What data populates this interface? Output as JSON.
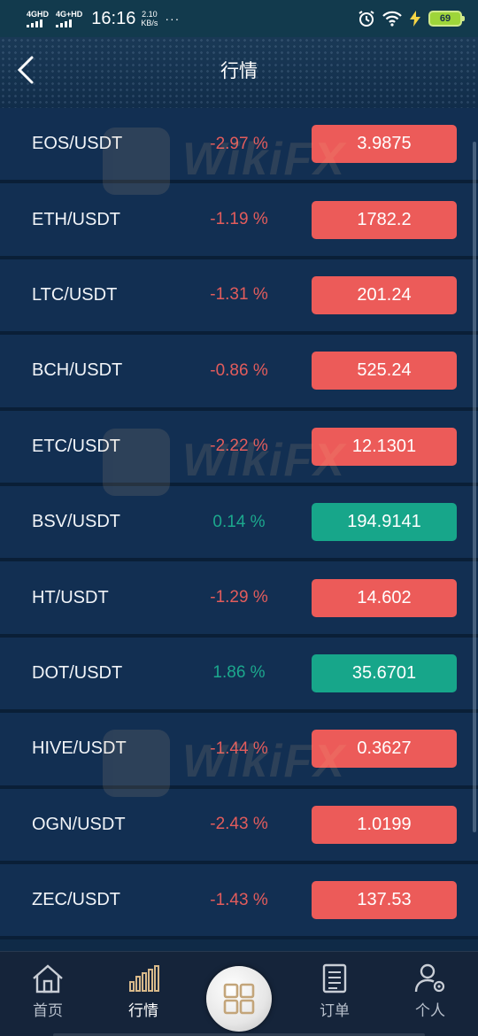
{
  "status_bar": {
    "network1": "4GHD",
    "network2": "4G+HD",
    "time": "16:16",
    "speed_value": "2.10",
    "speed_unit": "KB/s",
    "more": "···",
    "battery": "69"
  },
  "header": {
    "title": "行情"
  },
  "market": [
    {
      "pair": "EOS/USDT",
      "change": "-2.97 %",
      "price": "3.9875",
      "direction": "down"
    },
    {
      "pair": "ETH/USDT",
      "change": "-1.19 %",
      "price": "1782.2",
      "direction": "down"
    },
    {
      "pair": "LTC/USDT",
      "change": "-1.31 %",
      "price": "201.24",
      "direction": "down"
    },
    {
      "pair": "BCH/USDT",
      "change": "-0.86 %",
      "price": "525.24",
      "direction": "down"
    },
    {
      "pair": "ETC/USDT",
      "change": "-2.22 %",
      "price": "12.1301",
      "direction": "down"
    },
    {
      "pair": "BSV/USDT",
      "change": "0.14 %",
      "price": "194.9141",
      "direction": "up"
    },
    {
      "pair": "HT/USDT",
      "change": "-1.29 %",
      "price": "14.602",
      "direction": "down"
    },
    {
      "pair": "DOT/USDT",
      "change": "1.86 %",
      "price": "35.6701",
      "direction": "up"
    },
    {
      "pair": "HIVE/USDT",
      "change": "-1.44 %",
      "price": "0.3627",
      "direction": "down"
    },
    {
      "pair": "OGN/USDT",
      "change": "-2.43 %",
      "price": "1.0199",
      "direction": "down"
    },
    {
      "pair": "ZEC/USDT",
      "change": "-1.43 %",
      "price": "137.53",
      "direction": "down"
    }
  ],
  "watermark": {
    "text": "WikiFX"
  },
  "tabbar": {
    "home": "首页",
    "market": "行情",
    "orders": "订单",
    "profile": "个人"
  },
  "colors": {
    "down": "#ec5b59",
    "up": "#17a68a",
    "background": "#122f52"
  }
}
